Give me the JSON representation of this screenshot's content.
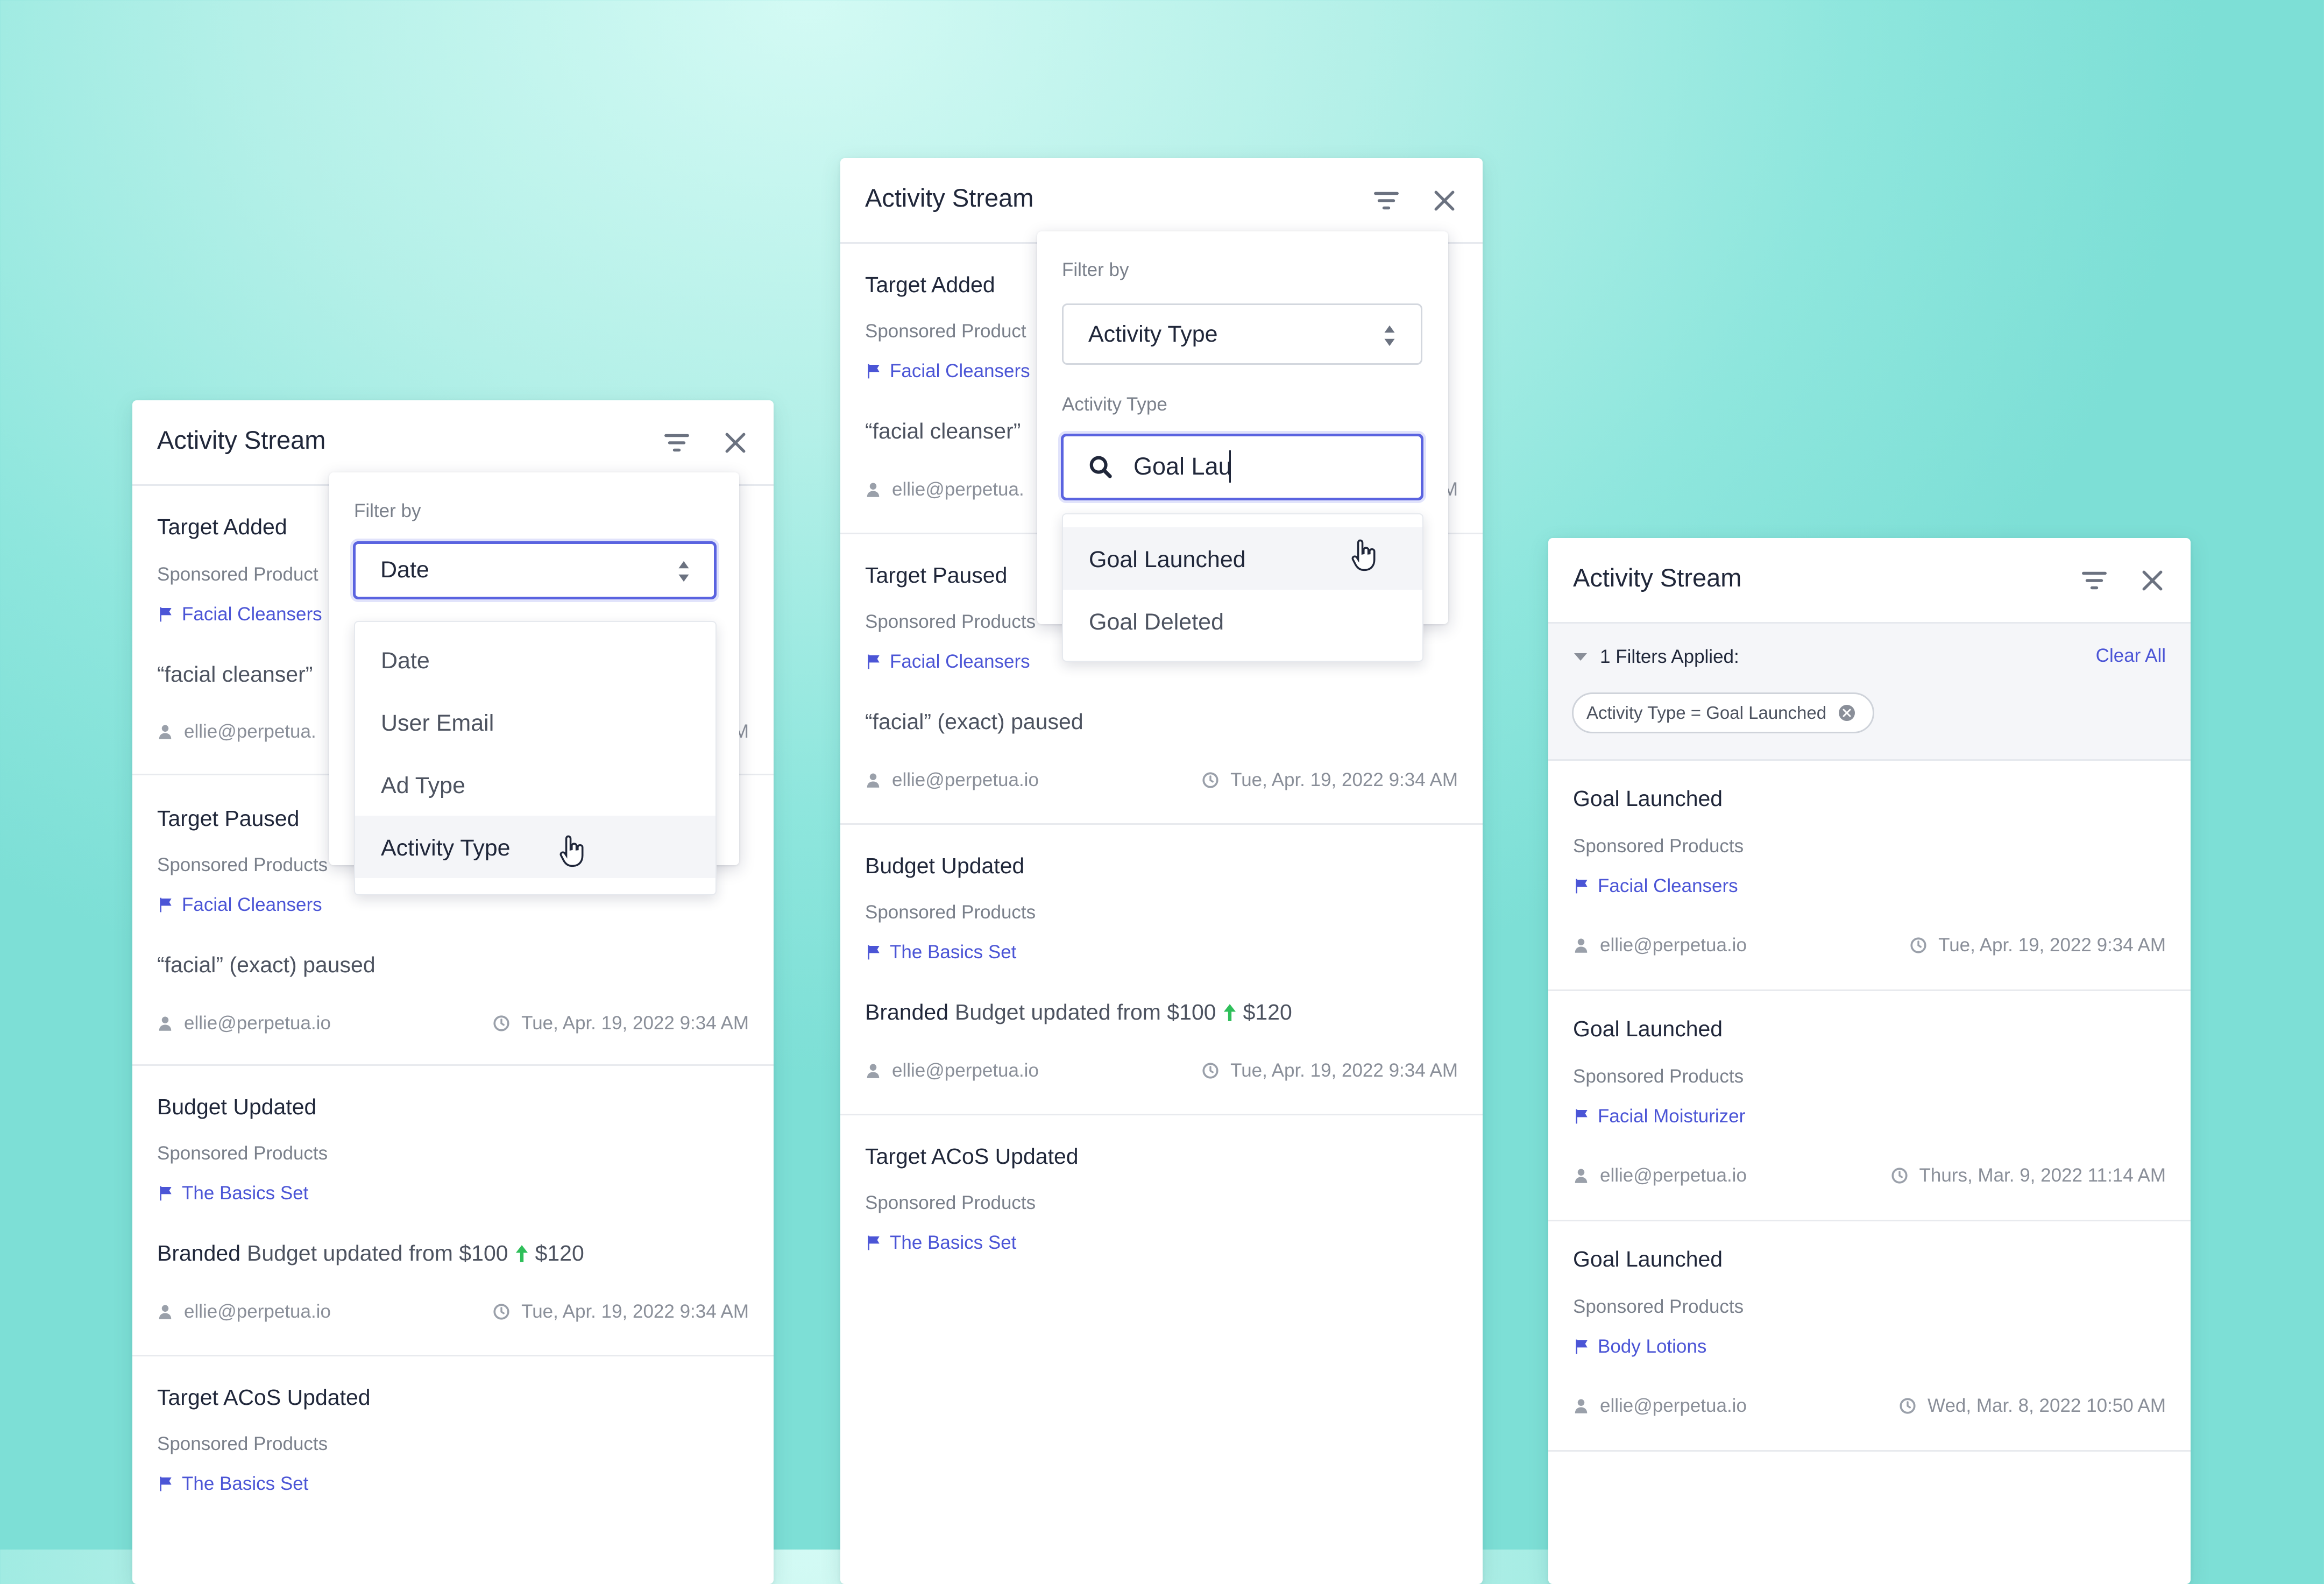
{
  "colors": {
    "accent": "#5a63e0",
    "link": "#4b55d6",
    "increase": "#2fbf5a"
  },
  "icons": {
    "filter": "filter-icon",
    "close": "close-icon",
    "user": "user-icon",
    "clock": "clock-icon",
    "flag": "flag-icon",
    "search": "search-icon",
    "arrow_up": "arrow-up-icon",
    "chevron": "chevron-down-icon",
    "clear": "clear-icon",
    "hand_cursor": "hand-cursor-icon"
  },
  "panel1": {
    "title": "Activity Stream",
    "items": [
      {
        "title": "Target Added",
        "sub": "Sponsored Product",
        "link": "Facial Cleansers",
        "desc": "“facial cleanser”",
        "user": "ellie@perpetua.",
        "time": "M"
      },
      {
        "title": "Target Paused",
        "sub": "Sponsored Products",
        "link": "Facial Cleansers",
        "desc": "“facial” (exact) paused",
        "user": "ellie@perpetua.io",
        "time": "Tue, Apr. 19, 2022 9:34 AM"
      },
      {
        "title": "Budget Updated",
        "sub": "Sponsored Products",
        "link": "The Basics Set",
        "desc_strong": "Branded",
        "desc": "Budget updated from $100",
        "desc_new": "$120",
        "user": "ellie@perpetua.io",
        "time": "Tue, Apr. 19, 2022 9:34 AM"
      },
      {
        "title": "Target ACoS Updated",
        "sub": "Sponsored Products",
        "link": "The Basics Set"
      }
    ],
    "filter": {
      "label": "Filter by",
      "selected": "Date",
      "options": [
        "Date",
        "User Email",
        "Ad Type",
        "Activity Type"
      ],
      "highlighted": "Activity Type"
    }
  },
  "panel2": {
    "title": "Activity Stream",
    "items": [
      {
        "title": "Target Added",
        "sub": "Sponsored Product",
        "link": "Facial Cleansers",
        "desc": "“facial cleanser”",
        "user": "ellie@perpetua.",
        "time": "M"
      },
      {
        "title": "Target Paused",
        "sub": "Sponsored Products",
        "link": "Facial Cleansers",
        "desc": "“facial” (exact) paused",
        "user": "ellie@perpetua.io",
        "time": "Tue, Apr. 19, 2022 9:34 AM"
      },
      {
        "title": "Budget Updated",
        "sub": "Sponsored Products",
        "link": "The Basics Set",
        "desc_strong": "Branded",
        "desc": "Budget updated from $100",
        "desc_new": "$120",
        "user": "ellie@perpetua.io",
        "time": "Tue, Apr. 19, 2022 9:34 AM"
      },
      {
        "title": "Target ACoS Updated",
        "sub": "Sponsored Products",
        "link": "The Basics Set"
      }
    ],
    "filter": {
      "label": "Filter by",
      "selected": "Activity Type",
      "type_label": "Activity Type",
      "search_value": "Goal Lau",
      "options": [
        "Goal Launched",
        "Goal Deleted"
      ],
      "highlighted": "Goal Launched"
    }
  },
  "panel3": {
    "title": "Activity Stream",
    "filters_applied": "1 Filters Applied:",
    "clear_all": "Clear All",
    "chip": "Activity Type = Goal Launched",
    "items": [
      {
        "title": "Goal Launched",
        "sub": "Sponsored Products",
        "link": "Facial Cleansers",
        "user": "ellie@perpetua.io",
        "time": "Tue, Apr. 19, 2022 9:34 AM"
      },
      {
        "title": "Goal Launched",
        "sub": "Sponsored Products",
        "link": "Facial Moisturizer",
        "user": "ellie@perpetua.io",
        "time": "Thurs, Mar. 9, 2022 11:14 AM"
      },
      {
        "title": "Goal Launched",
        "sub": "Sponsored Products",
        "link": "Body Lotions",
        "user": "ellie@perpetua.io",
        "time": "Wed, Mar. 8, 2022 10:50 AM"
      }
    ]
  }
}
